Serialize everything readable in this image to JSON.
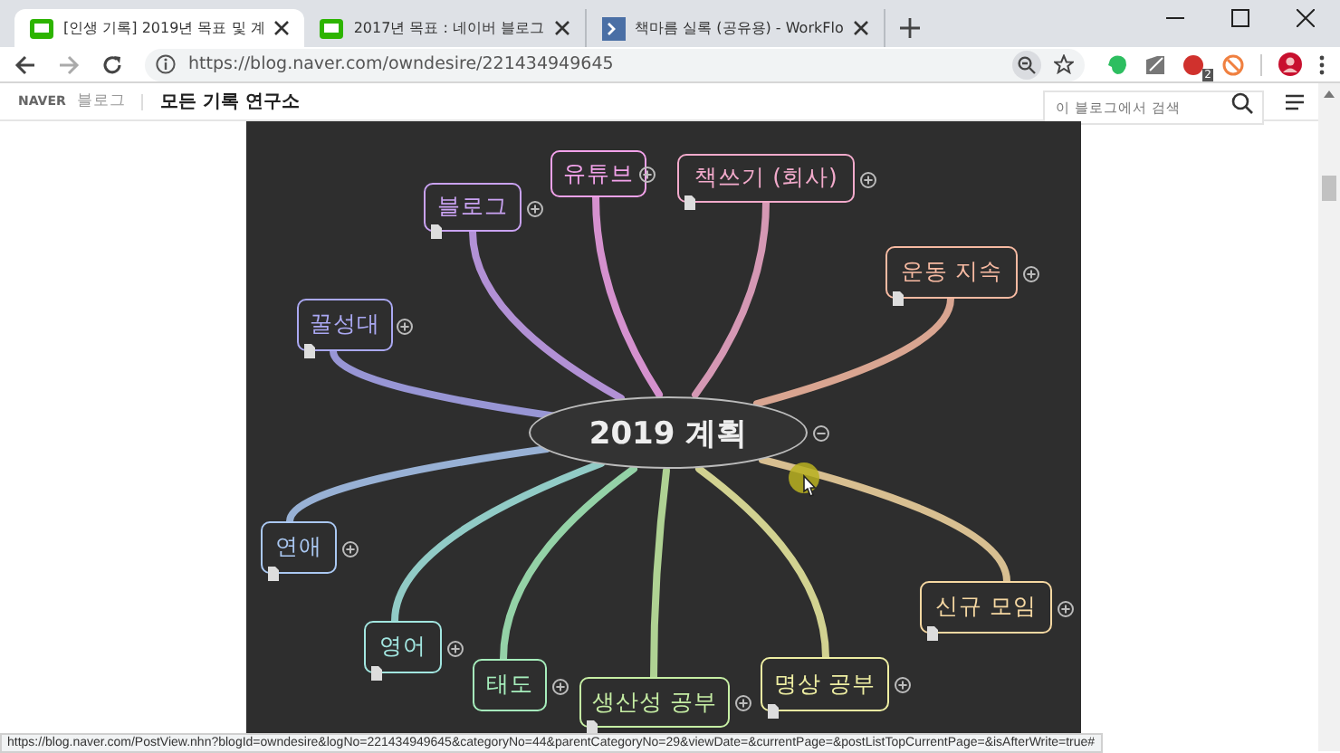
{
  "browser": {
    "tabs": [
      {
        "title": "[인생 기록] 2019년 목표 및 계",
        "selected": true,
        "kind": "blog"
      },
      {
        "title": "2017년 목표 : 네이버 블로그",
        "selected": false,
        "kind": "blog"
      },
      {
        "title": "책마름 실록 (공유용) - WorkFlo",
        "selected": false,
        "kind": "workflowy"
      }
    ],
    "url": "https://blog.naver.com/owndesire/221434949645",
    "extension_badge": "2"
  },
  "blog_header": {
    "brand": "NAVER",
    "section": "블로그",
    "blog_name": "모든 기록 연구소",
    "search": {
      "placeholder": "이 블로그에서 검색"
    }
  },
  "mindmap": {
    "center": {
      "label": "2019 계획",
      "collapsed": false
    },
    "branches": [
      {
        "label": "꿀성대",
        "color": "#aaa8f2",
        "collapsed": true,
        "has_note": true
      },
      {
        "label": "블로그",
        "color": "#c9a2f2",
        "collapsed": true,
        "has_note": true
      },
      {
        "label": "유튜브",
        "color": "#f2a2ea",
        "collapsed": true,
        "has_note": false
      },
      {
        "label": "책쓰기 (회사)",
        "color": "#f2aacb",
        "collapsed": true,
        "has_note": true
      },
      {
        "label": "운동 지속",
        "color": "#f7baa2",
        "collapsed": true,
        "has_note": true
      },
      {
        "label": "연애",
        "color": "#aac8f2",
        "collapsed": true,
        "has_note": true
      },
      {
        "label": "영어",
        "color": "#a2e6e0",
        "collapsed": true,
        "has_note": true
      },
      {
        "label": "태도",
        "color": "#a6eebc",
        "collapsed": true,
        "has_note": false
      },
      {
        "label": "생산성 공부",
        "color": "#c6eea4",
        "collapsed": true,
        "has_note": true
      },
      {
        "label": "명상 공부",
        "color": "#eeeea2",
        "collapsed": true,
        "has_note": true
      },
      {
        "label": "신규 모임",
        "color": "#f6d8a2",
        "collapsed": true,
        "has_note": true
      }
    ]
  },
  "status_bar": {
    "url": "https://blog.naver.com/PostView.nhn?blogId=owndesire&logNo=221434949645&categoryNo=44&parentCategoryNo=29&viewDate=&currentPage=&postListTopCurrentPage=&isAfterWrite=true#"
  }
}
